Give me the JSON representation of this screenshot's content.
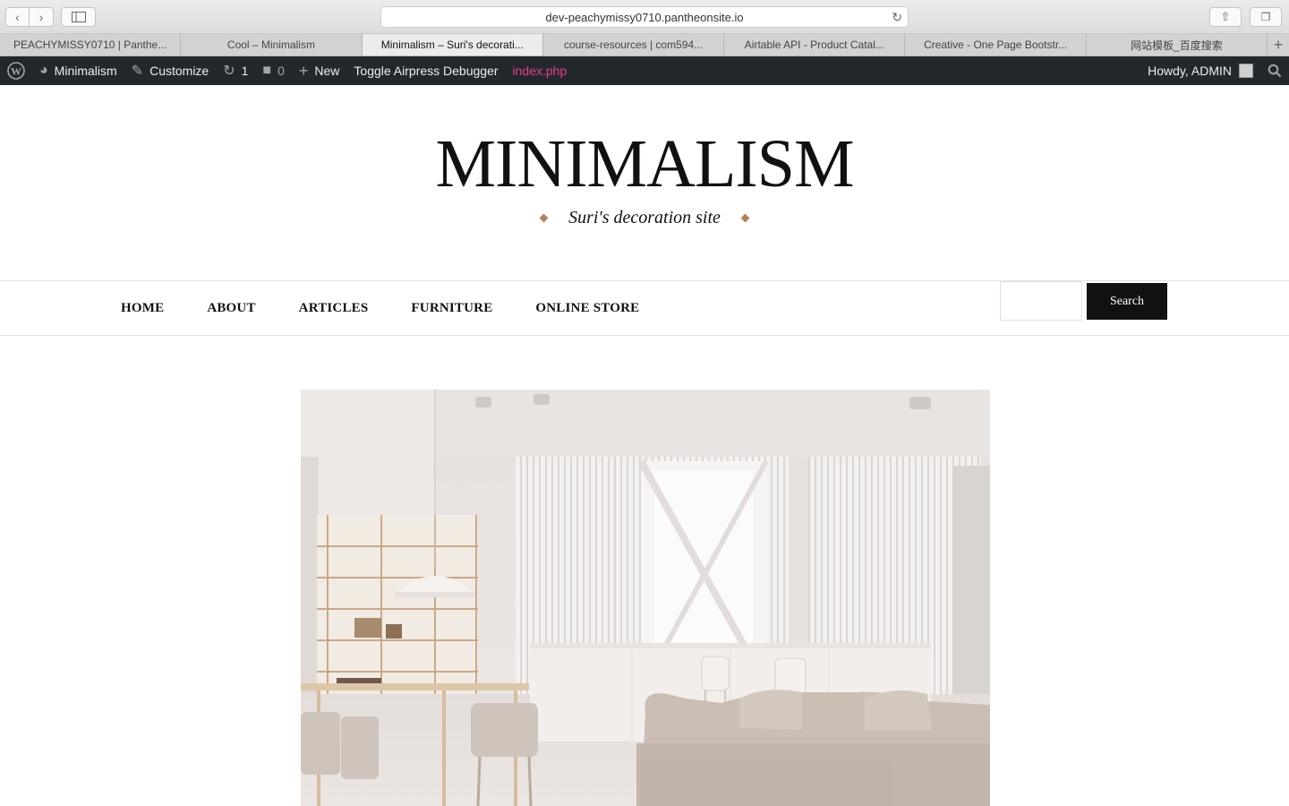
{
  "browser": {
    "url": "dev-peachymissy0710.pantheonsite.io",
    "tabs": [
      {
        "label": "PEACHYMISSY0710 | Panthe..."
      },
      {
        "label": "Cool – Minimalism"
      },
      {
        "label": "Minimalism – Suri's decorati..."
      },
      {
        "label": "course-resources | com594..."
      },
      {
        "label": "Airtable API - Product Catal..."
      },
      {
        "label": "Creative - One Page Bootstr..."
      },
      {
        "label": "网站模板_百度搜索"
      }
    ],
    "active_tab_index": 2
  },
  "adminbar": {
    "site_name": "Minimalism",
    "customize": "Customize",
    "updates_count": "1",
    "comments_count": "0",
    "new": "New",
    "debugger": "Toggle Airpress Debugger",
    "file": "index.php",
    "howdy": "Howdy, ADMIN"
  },
  "site": {
    "title": "MINIMALISM",
    "tagline": "Suri's decoration site",
    "accent": "#b5835a"
  },
  "nav": {
    "items": [
      "HOME",
      "ABOUT",
      "ARTICLES",
      "FURNITURE",
      "ONLINE STORE"
    ],
    "search_label": "Search"
  },
  "hero": {
    "description": "minimalist interior with dining area, shelving, kitchen island and beige sofa"
  }
}
